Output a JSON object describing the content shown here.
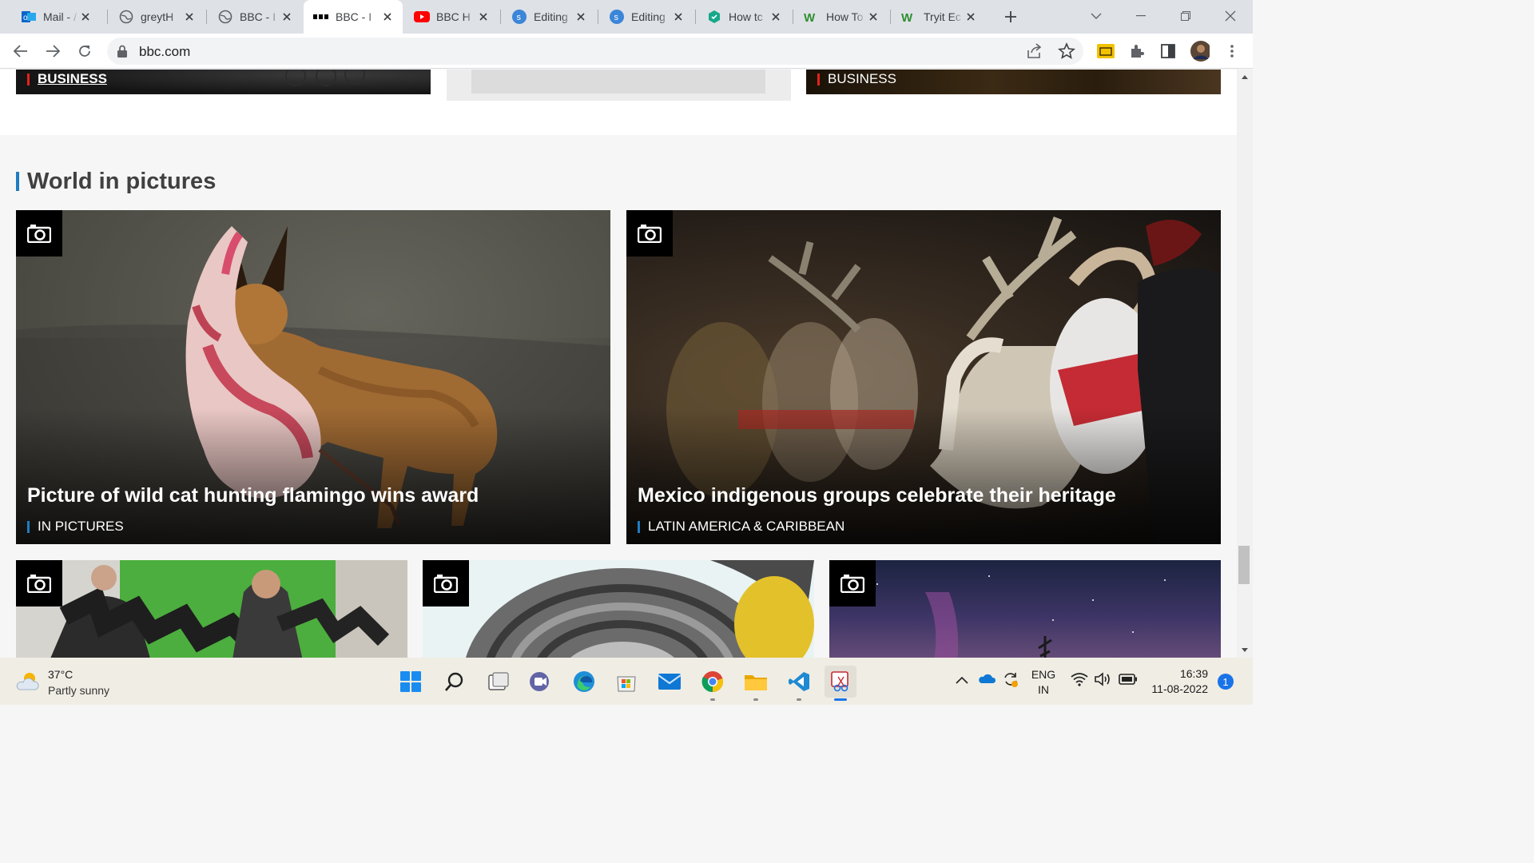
{
  "browser": {
    "tabs": [
      {
        "title": "Mail - /",
        "icon": "outlook-icon",
        "active": false
      },
      {
        "title": "greytH",
        "icon": "globe-icon",
        "active": false
      },
      {
        "title": "BBC - I",
        "icon": "globe-icon",
        "active": false
      },
      {
        "title": "BBC - I",
        "icon": "bbc-icon",
        "active": true
      },
      {
        "title": "BBC H",
        "icon": "youtube-icon",
        "active": false
      },
      {
        "title": "Editing",
        "icon": "simplenote-icon",
        "active": false
      },
      {
        "title": "Editing",
        "icon": "simplenote-icon",
        "active": false
      },
      {
        "title": "How tc",
        "icon": "hexagon-icon",
        "active": false
      },
      {
        "title": "How To",
        "icon": "wikihow-icon",
        "active": false
      },
      {
        "title": "Tryit Ec",
        "icon": "wikihow-icon",
        "active": false
      }
    ],
    "url": "bbc.com"
  },
  "page": {
    "top_cards": [
      {
        "tag": "BUSINESS",
        "underlined": true
      },
      {
        "tag": "BUSINESS",
        "underlined": false
      }
    ],
    "section_title": "World in pictures",
    "featured": [
      {
        "headline": "Picture of wild cat hunting flamingo wins award",
        "category": "IN PICTURES"
      },
      {
        "headline": "Mexico indigenous groups celebrate their heritage",
        "category": "LATIN AMERICA & CARIBBEAN"
      }
    ],
    "more_cards": [
      {
        "label": "dancers"
      },
      {
        "label": "armor"
      },
      {
        "label": "aurora"
      }
    ]
  },
  "taskbar": {
    "weather": {
      "temp": "37°C",
      "desc": "Partly sunny"
    },
    "language": {
      "line1": "ENG",
      "line2": "IN"
    },
    "clock": {
      "time": "16:39",
      "date": "11-08-2022"
    },
    "notification_count": "1"
  },
  "colors": {
    "bbc_accent_red": "#e3231a",
    "bbc_accent_blue": "#1f7cc1",
    "chrome_tabstrip": "#dee1e6"
  }
}
